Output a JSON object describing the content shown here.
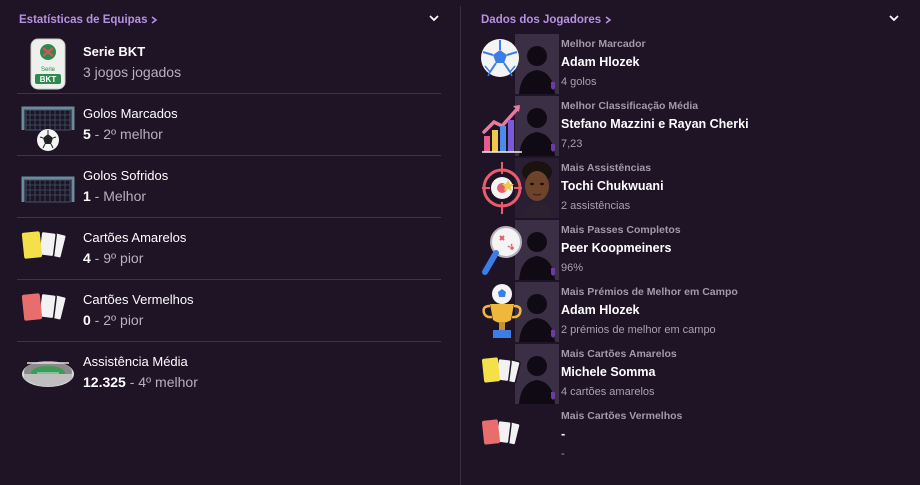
{
  "team_stats": {
    "title": "Estatísticas de Equipas",
    "rows": [
      {
        "icon": "serie-bkt-logo",
        "label": "Serie BKT",
        "value_text": "3 jogos jogados"
      },
      {
        "icon": "goal-ball-icon",
        "label": "Golos Marcados",
        "number": "5",
        "rank": " - 2º melhor"
      },
      {
        "icon": "goal-net-icon",
        "label": "Golos Sofridos",
        "number": "1",
        "rank": " - Melhor"
      },
      {
        "icon": "yellow-cards-icon",
        "label": "Cartões Amarelos",
        "number": "4",
        "rank": " - 9º pior"
      },
      {
        "icon": "red-cards-icon",
        "label": "Cartões Vermelhos",
        "number": "0",
        "rank": " - 2º pior"
      },
      {
        "icon": "stadium-icon",
        "label": "Assistência Média",
        "number": "12.325",
        "rank": " - 4º melhor"
      }
    ]
  },
  "player_stats": {
    "title": "Dados dos Jogadores",
    "rows": [
      {
        "icon": "football-icon",
        "label": "Melhor Marcador",
        "name": "Adam Hlozek",
        "value": "4 golos"
      },
      {
        "icon": "rating-chart-icon",
        "label": "Melhor Classificação Média",
        "name": "Stefano Mazzini e Rayan Cherki",
        "value": "7,23"
      },
      {
        "icon": "assist-target-icon",
        "label": "Mais Assistências",
        "name": "Tochi Chukwuani",
        "value": "2 assistências"
      },
      {
        "icon": "pass-magnifier-icon",
        "label": "Mais Passes Completos",
        "name": "Peer Koopmeiners",
        "value": "96%"
      },
      {
        "icon": "trophy-icon",
        "label": "Mais Prémios de Melhor em Campo",
        "name": "Adam Hlozek",
        "value": "2 prémios de melhor em campo"
      },
      {
        "icon": "yellow-cards-icon",
        "label": "Mais Cartões Amarelos",
        "name": "Michele Somma",
        "value": "4 cartões amarelos"
      },
      {
        "icon": "red-cards-icon",
        "label": "Mais Cartões Vermelhos",
        "name": "-",
        "value": "-"
      }
    ]
  },
  "colors": {
    "background": "#1f1326",
    "header_accent": "#b890e2",
    "divider": "#3e3347"
  }
}
